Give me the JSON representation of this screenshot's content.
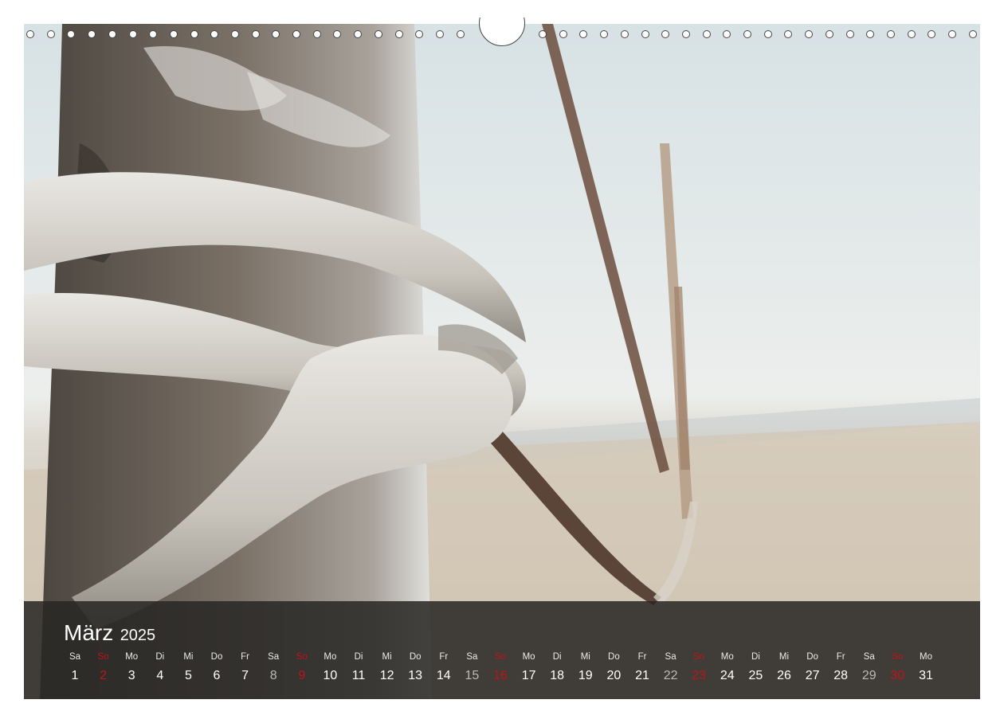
{
  "calendar": {
    "month": "März",
    "year": "2025",
    "days": [
      {
        "dn": "Sa",
        "dd": "1",
        "kind": "weekday"
      },
      {
        "dn": "So",
        "dd": "2",
        "kind": "sun"
      },
      {
        "dn": "Mo",
        "dd": "3",
        "kind": "weekday"
      },
      {
        "dn": "Di",
        "dd": "4",
        "kind": "weekday"
      },
      {
        "dn": "Mi",
        "dd": "5",
        "kind": "weekday"
      },
      {
        "dn": "Do",
        "dd": "6",
        "kind": "weekday"
      },
      {
        "dn": "Fr",
        "dd": "7",
        "kind": "weekday"
      },
      {
        "dn": "Sa",
        "dd": "8",
        "kind": "sat"
      },
      {
        "dn": "So",
        "dd": "9",
        "kind": "sun"
      },
      {
        "dn": "Mo",
        "dd": "10",
        "kind": "weekday"
      },
      {
        "dn": "Di",
        "dd": "11",
        "kind": "weekday"
      },
      {
        "dn": "Mi",
        "dd": "12",
        "kind": "weekday"
      },
      {
        "dn": "Do",
        "dd": "13",
        "kind": "weekday"
      },
      {
        "dn": "Fr",
        "dd": "14",
        "kind": "weekday"
      },
      {
        "dn": "Sa",
        "dd": "15",
        "kind": "sat"
      },
      {
        "dn": "So",
        "dd": "16",
        "kind": "sun"
      },
      {
        "dn": "Mo",
        "dd": "17",
        "kind": "weekday"
      },
      {
        "dn": "Di",
        "dd": "18",
        "kind": "weekday"
      },
      {
        "dn": "Mi",
        "dd": "19",
        "kind": "weekday"
      },
      {
        "dn": "Do",
        "dd": "20",
        "kind": "weekday"
      },
      {
        "dn": "Fr",
        "dd": "21",
        "kind": "weekday"
      },
      {
        "dn": "Sa",
        "dd": "22",
        "kind": "sat"
      },
      {
        "dn": "So",
        "dd": "23",
        "kind": "sun"
      },
      {
        "dn": "Mo",
        "dd": "24",
        "kind": "weekday"
      },
      {
        "dn": "Di",
        "dd": "25",
        "kind": "weekday"
      },
      {
        "dn": "Mi",
        "dd": "26",
        "kind": "weekday"
      },
      {
        "dn": "Do",
        "dd": "27",
        "kind": "weekday"
      },
      {
        "dn": "Fr",
        "dd": "28",
        "kind": "weekday"
      },
      {
        "dn": "Sa",
        "dd": "29",
        "kind": "sat"
      },
      {
        "dn": "So",
        "dd": "30",
        "kind": "sun"
      },
      {
        "dn": "Mo",
        "dd": "31",
        "kind": "weekday"
      }
    ]
  },
  "colors": {
    "sunday": "#c0121a",
    "saturday": "#b9b9b9",
    "strip_bg": "#282624"
  },
  "photo": {
    "subject_icon": "rope-knot-on-post-photo"
  }
}
